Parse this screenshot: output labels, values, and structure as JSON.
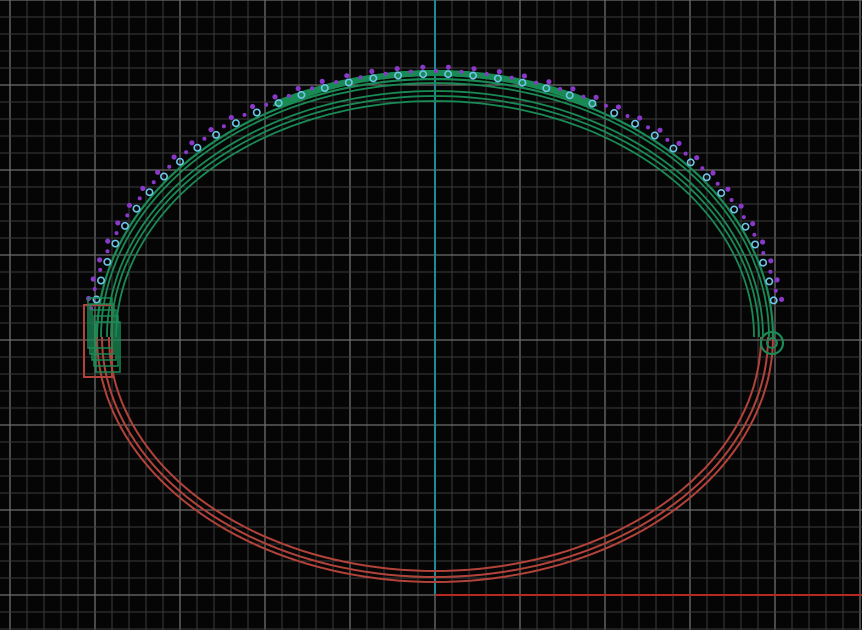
{
  "viewport": {
    "view": "top",
    "background_color": "#050505",
    "grid": {
      "visible": true,
      "minor_color": "#3a3a3a",
      "major_color": "#6e6e6e"
    },
    "axes": {
      "vertical_axis_color": "#1f8a96",
      "horizontal_axis_color": "#b42a22"
    }
  },
  "model": {
    "name": "bangle-bracelet",
    "parts": [
      {
        "name": "lower-band",
        "color": "#b2433a"
      },
      {
        "name": "upper-band",
        "color": "#1a8a55"
      },
      {
        "name": "stone-settings",
        "color": "#6ec6ea"
      },
      {
        "name": "prongs",
        "color": "#8a38c8"
      },
      {
        "name": "clasp-box",
        "color": "#1a8a55"
      },
      {
        "name": "hinge",
        "color": "#1a8a55"
      }
    ]
  }
}
